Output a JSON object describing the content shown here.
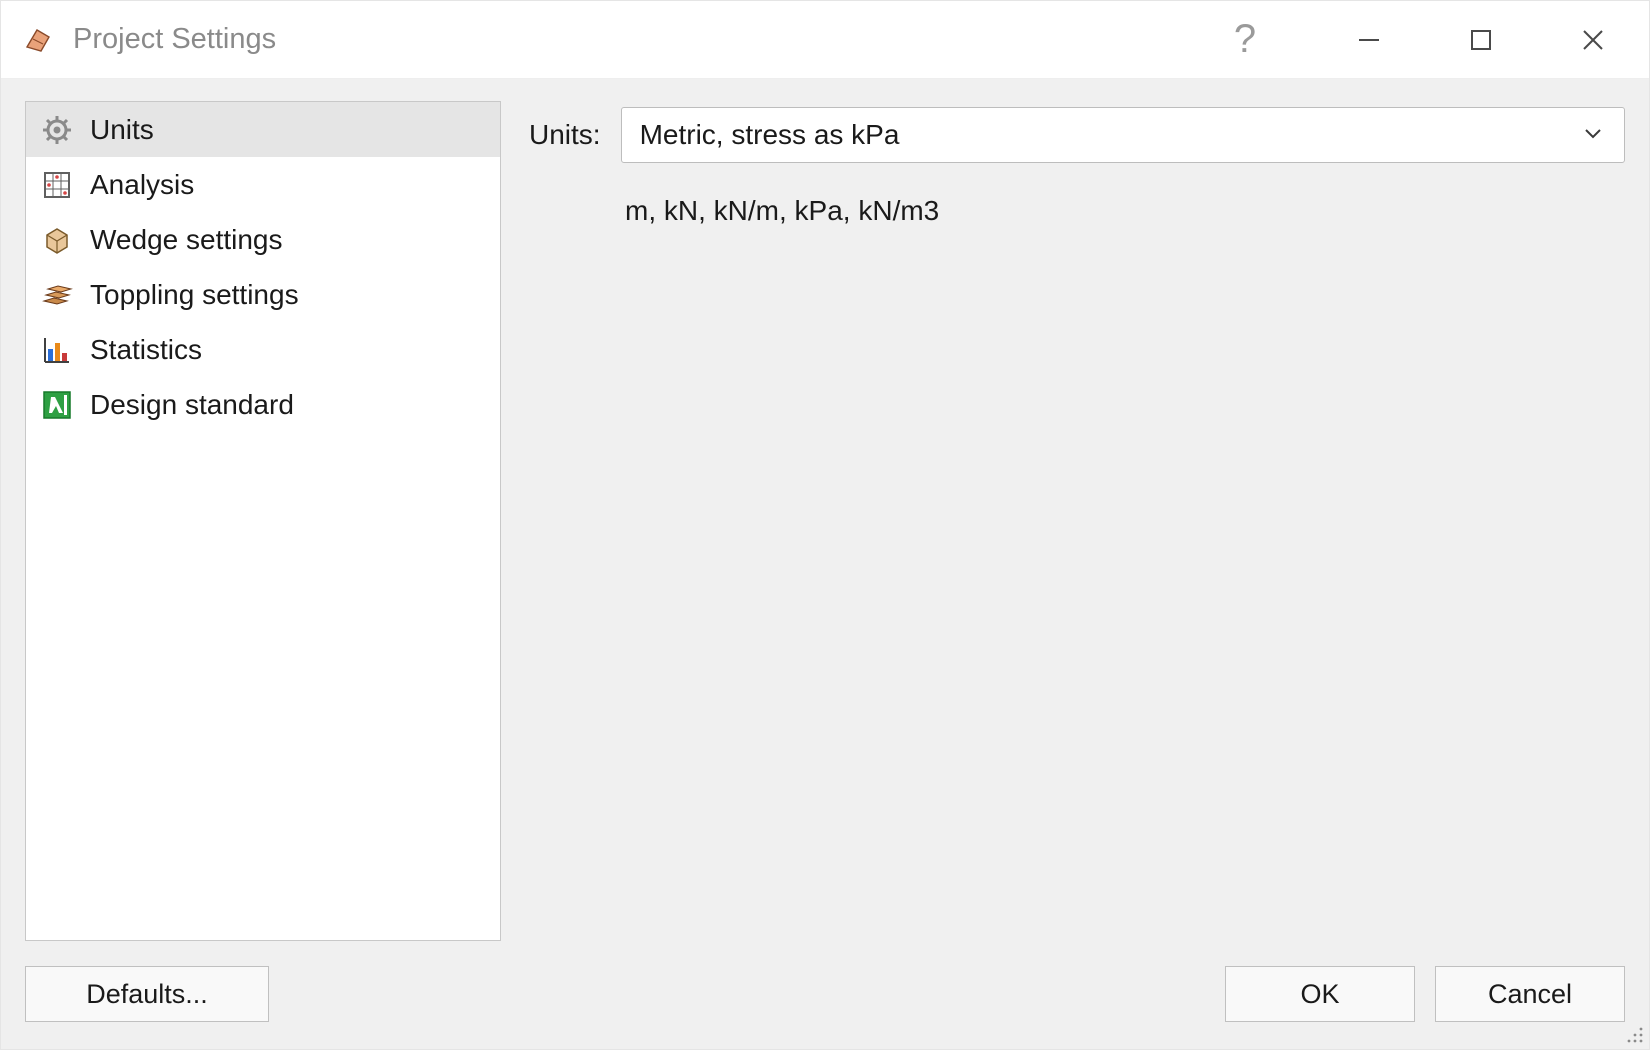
{
  "window": {
    "title": "Project Settings"
  },
  "sidebar": {
    "items": [
      {
        "label": "Units",
        "icon": "gear-icon",
        "selected": true
      },
      {
        "label": "Analysis",
        "icon": "grid-icon",
        "selected": false
      },
      {
        "label": "Wedge settings",
        "icon": "box-icon",
        "selected": false
      },
      {
        "label": "Toppling settings",
        "icon": "stack-icon",
        "selected": false
      },
      {
        "label": "Statistics",
        "icon": "bar-chart-icon",
        "selected": false
      },
      {
        "label": "Design standard",
        "icon": "lambda-icon",
        "selected": false
      }
    ]
  },
  "main": {
    "units_label": "Units:",
    "units_value": "Metric, stress as kPa",
    "units_hint": "m, kN, kN/m, kPa, kN/m3"
  },
  "buttons": {
    "defaults": "Defaults...",
    "ok": "OK",
    "cancel": "Cancel"
  }
}
